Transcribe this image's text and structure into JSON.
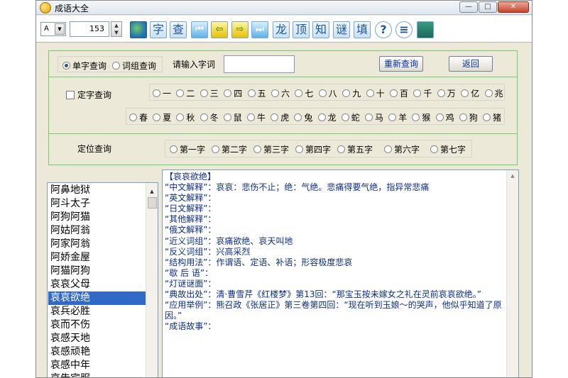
{
  "window": {
    "title": "成语大全",
    "controls": {
      "minimize": "—",
      "maximize": "□",
      "close": "✕"
    }
  },
  "toolbar": {
    "font_value": "A",
    "size_value": "153",
    "buttons": [
      {
        "icon": "globe-icon",
        "label": ""
      },
      {
        "icon": "char-icon",
        "label": "字"
      },
      {
        "icon": "search-icon",
        "label": "查"
      },
      {
        "icon": "first-icon",
        "label": "⏮"
      },
      {
        "icon": "prev-icon",
        "label": "⇦"
      },
      {
        "icon": "next-icon",
        "label": "⇨"
      },
      {
        "icon": "last-icon",
        "label": "⏭"
      },
      {
        "icon": "dragon-icon",
        "label": "龙"
      },
      {
        "icon": "top-icon",
        "label": "顶"
      },
      {
        "icon": "know-icon",
        "label": "知"
      },
      {
        "icon": "riddle-icon",
        "label": "谜"
      },
      {
        "icon": "fill-icon",
        "label": "填"
      },
      {
        "icon": "help-icon",
        "label": "?"
      },
      {
        "icon": "menu-icon",
        "label": "≡"
      },
      {
        "icon": "book-icon",
        "label": ""
      }
    ]
  },
  "query": {
    "mode_options": [
      {
        "label": "单字查询",
        "selected": true
      },
      {
        "label": "词组查询",
        "selected": false
      }
    ],
    "input_label": "请输入字词",
    "input_value": "",
    "requery_button": "重新查询",
    "back_button": "返回",
    "fixed_char_label": "定字查询",
    "numbers": [
      "一",
      "二",
      "三",
      "四",
      "五",
      "六",
      "七",
      "八",
      "九",
      "十",
      "百",
      "千",
      "万",
      "亿",
      "兆"
    ],
    "seasons_zodiac": [
      "春",
      "夏",
      "秋",
      "冬",
      "鼠",
      "牛",
      "虎",
      "兔",
      "龙",
      "蛇",
      "马",
      "羊",
      "猴",
      "鸡",
      "狗",
      "猪"
    ],
    "position_label": "定位查询",
    "positions": [
      "第一字",
      "第二字",
      "第三字",
      "第四字",
      "第五字",
      "第六字",
      "第七字"
    ]
  },
  "idiom_list": {
    "items": [
      "阿鼻地狱",
      "阿斗太子",
      "阿狗阿猫",
      "阿姑阿翁",
      "阿家阿翁",
      "阿娇金屋",
      "阿猫阿狗",
      "哀哀父母",
      "哀哀欲绝",
      "哀兵必胜",
      "哀而不伤",
      "哀感天地",
      "哀感顽艳",
      "哀感中年",
      "哀告宾服"
    ],
    "selected_index": 8
  },
  "detail": {
    "lines": [
      "【哀哀欲绝】",
      "“中文解释”：哀哀：悲伤不止；绝：气绝。悲痛得要气绝，指异常悲痛",
      "“英文解释”：",
      "“日文解释”：",
      "“其他解释”：",
      "“俄文解释”：",
      "“近义词组”：哀痛欲绝、哀天叫地",
      "“反义词组”：兴高采烈",
      "“结构用法”：作谓语、定语、补语；形容极度悲哀",
      "“歇 后 语”：",
      "“灯谜谜面”：",
      "“典故出处”：清·曹雪芹《红楼梦》第13回：“那宝玉按未嫁女之礼在灵前哀哀欲绝。”",
      "“应用举例”：熊召政《张居正》第三卷第四回：“现在听到玉娘～的哭声，他似乎知道了原因。”",
      "“成语故事”："
    ]
  }
}
